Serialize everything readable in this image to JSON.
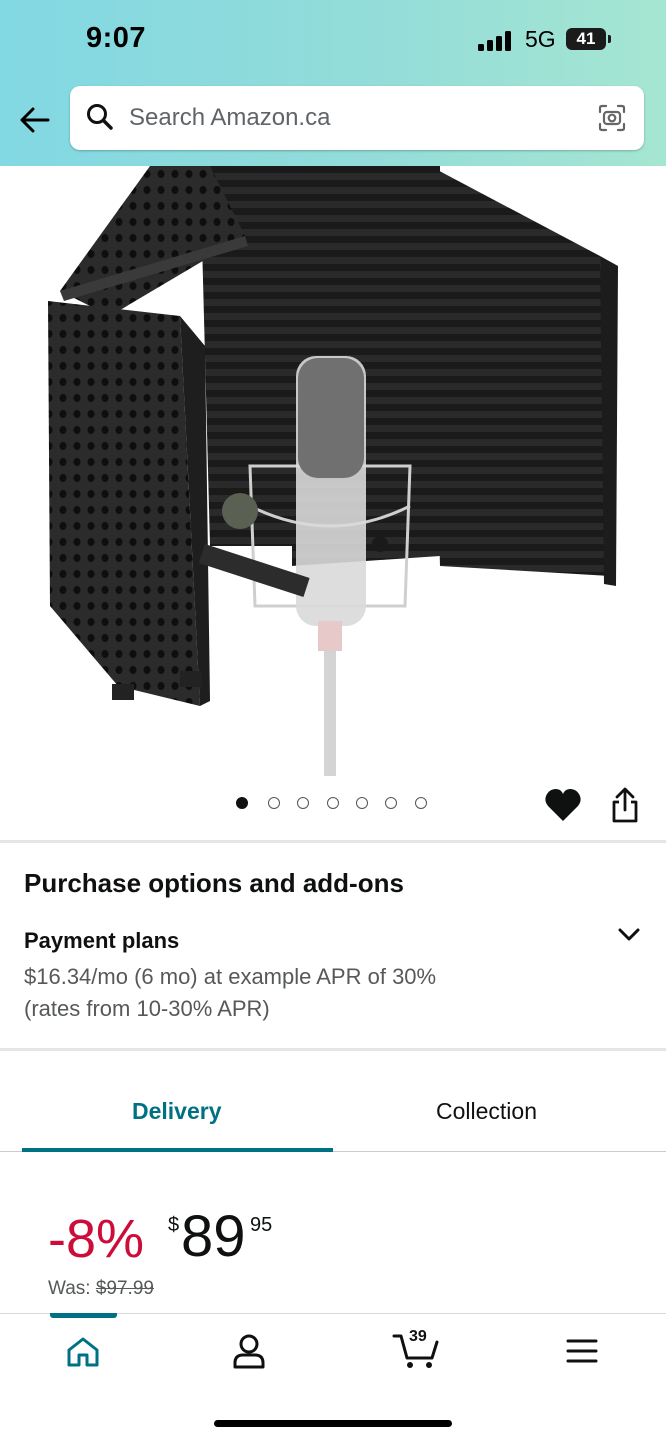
{
  "status_bar": {
    "time": "9:07",
    "network": "5G",
    "battery": "41"
  },
  "header": {
    "search_placeholder": "Search Amazon.ca"
  },
  "gallery": {
    "image_count": 7,
    "active_index": 0
  },
  "purchase_options": {
    "title": "Purchase options and add-ons",
    "payment_plans_label": "Payment plans",
    "payment_line1": "$16.34/mo (6 mo) at example APR of 30%",
    "payment_line2": "(rates from 10-30% APR)"
  },
  "tabs": {
    "delivery": "Delivery",
    "collection": "Collection",
    "active": "Delivery"
  },
  "price": {
    "discount": "-8%",
    "currency": "$",
    "whole": "89",
    "fraction": "95",
    "was_label": "Was:",
    "was_price": "$97.99"
  },
  "bottom_nav": {
    "cart_count": "39",
    "active": "home"
  },
  "colors": {
    "accent": "#007185",
    "discount": "#cc0c39"
  }
}
